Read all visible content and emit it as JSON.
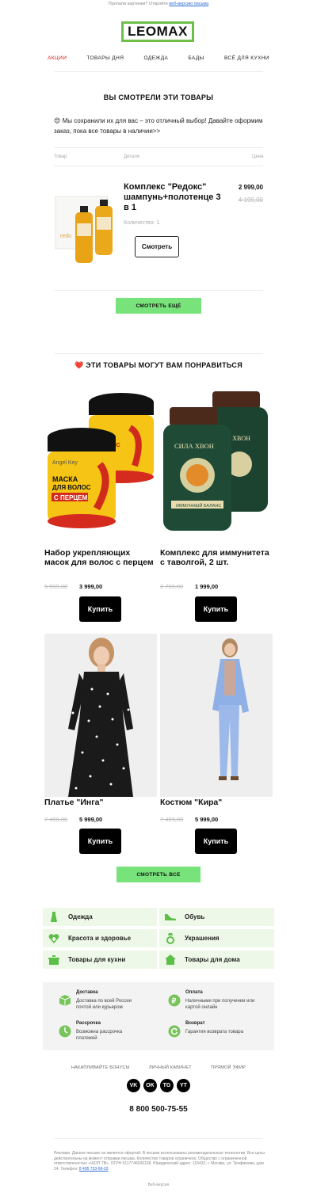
{
  "preheader": {
    "text": "Пропали картинки? Откройте",
    "link": "веб-версию письма"
  },
  "logo": "LEOMAX",
  "nav": [
    "АКЦИИ",
    "ТОВАРЫ ДНЯ",
    "ОДЕЖДА",
    "БАДЫ",
    "ВСЁ ДЛЯ КУХНИ"
  ],
  "viewed": {
    "title": "ВЫ СМОТРЕЛИ ЭТИ ТОВАРЫ",
    "intro": "😍 Мы сохранили их для вас – это отличный выбор! Давайте оформим заказ, пока все товары в наличии>>",
    "headers": {
      "product": "Товар",
      "details": "Детали",
      "price": "Цена"
    },
    "item": {
      "title": "Комплекс \"Редокс\" шампунь+полотенце 3 в 1",
      "price": "2 999,00",
      "old_price": "4 199,00",
      "qty": "Количество: 1",
      "button": "Смотреть"
    },
    "more_button": "СМОТРЕТЬ ЕЩЁ"
  },
  "recommend": {
    "title": "❤️ ЭТИ ТОВАРЫ МОГУТ ВАМ ПОНРАВИТЬСЯ",
    "products": [
      {
        "title": "Набор укрепляющих масок для волос с перцем",
        "old": "5 599,00",
        "price": "3 999,00",
        "button": "Купить"
      },
      {
        "title": "Комплекс для иммунитета с таволгой, 2 шт.",
        "old": "2 799,00",
        "price": "1 999,00",
        "button": "Купить"
      },
      {
        "title": "Платье \"Инга\"",
        "old": "7 499,00",
        "price": "5 999,00",
        "button": "Купить"
      },
      {
        "title": "Костюм \"Кира\"",
        "old": "7 499,00",
        "price": "5 999,00",
        "button": "Купить"
      }
    ],
    "all_button": "СМОТРЕТЬ ВСЕ"
  },
  "categories": [
    "Одежда",
    "Обувь",
    "Красота и здоровье",
    "Украшения",
    "Товары для кухни",
    "Товары для дома"
  ],
  "info": [
    {
      "title": "Доставка",
      "text": "Доставка по всей России почтой или курьером"
    },
    {
      "title": "Оплата",
      "text": "Наличными при получении или картой онлайн"
    },
    {
      "title": "Рассрочка",
      "text": "Возможна рассрочка платежей"
    },
    {
      "title": "Возврат",
      "text": "Гарантия возврата товара"
    }
  ],
  "footer_links": [
    "НАКАПЛИВАЙТЕ БОНУСЫ",
    "ЛИЧНЫЙ КАБИНЕТ",
    "ПРЯМОЙ ЭФИР"
  ],
  "social": [
    "VK",
    "OK",
    "TG",
    "YT"
  ],
  "phone": "8 800 500-75-55",
  "legal": "Реклама. Данное письмо не является офертой. В письме использованы рекомендательные технологии. Все цены действительны на момент отправки письма. Количество товаров ограничено. Общество с ограниченной ответственностью «ШОП ТВ». ОГРН 5117746036128. Юридический адрес: 115432, г. Москва, ул. Трофимова, дом 24. Телефон:",
  "legal_phone": "8 495 733-96-03",
  "web_version": "Веб-версия",
  "colors": {
    "accent_green": "#78e37a",
    "logo_green": "#6cc04a",
    "active_nav": "#d62020",
    "category_bg": "#eef8e8"
  }
}
